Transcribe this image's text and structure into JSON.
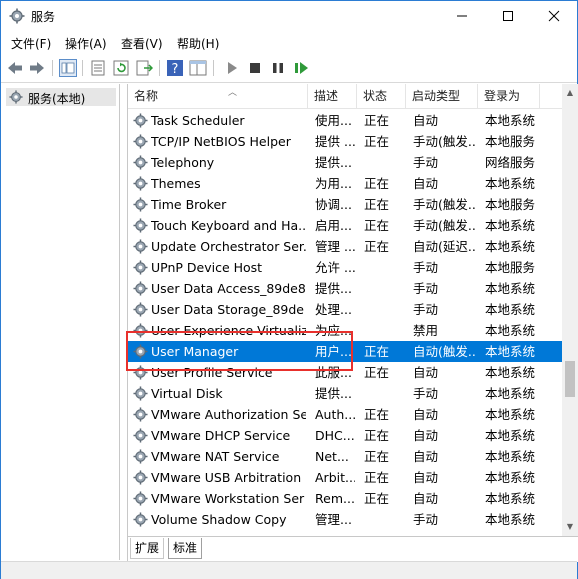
{
  "window": {
    "title": "服务"
  },
  "menu": [
    "文件(F)",
    "操作(A)",
    "查看(V)",
    "帮助(H)"
  ],
  "toolbar_icons": [
    "back-arrow-icon",
    "forward-arrow-icon",
    "console-tree-icon",
    "properties-icon",
    "refresh-icon",
    "export-list-icon",
    "help-icon",
    "show-hide-icon",
    "start-service-icon",
    "stop-service-icon",
    "pause-service-icon",
    "resume-service-icon"
  ],
  "tree": {
    "root_label": "服务(本地)"
  },
  "columns": [
    "名称",
    "描述",
    "状态",
    "启动类型",
    "登录为"
  ],
  "services": [
    {
      "name": "Task Scheduler",
      "desc": "使用...",
      "status": "正在",
      "startup": "自动",
      "logon": "本地系统"
    },
    {
      "name": "TCP/IP NetBIOS Helper",
      "desc": "提供 ...",
      "status": "正在",
      "startup": "手动(触发...",
      "logon": "本地服务"
    },
    {
      "name": "Telephony",
      "desc": "提供...",
      "status": "",
      "startup": "手动",
      "logon": "网络服务"
    },
    {
      "name": "Themes",
      "desc": "为用...",
      "status": "正在",
      "startup": "自动",
      "logon": "本地系统"
    },
    {
      "name": "Time Broker",
      "desc": "协调...",
      "status": "正在",
      "startup": "手动(触发...",
      "logon": "本地服务"
    },
    {
      "name": "Touch Keyboard and Ha...",
      "desc": "启用...",
      "status": "正在",
      "startup": "手动(触发...",
      "logon": "本地系统"
    },
    {
      "name": "Update Orchestrator Ser...",
      "desc": "管理 ...",
      "status": "正在",
      "startup": "自动(延迟...",
      "logon": "本地系统"
    },
    {
      "name": "UPnP Device Host",
      "desc": "允许 ...",
      "status": "",
      "startup": "手动",
      "logon": "本地服务"
    },
    {
      "name": "User Data Access_89de8d",
      "desc": "提供...",
      "status": "",
      "startup": "手动",
      "logon": "本地系统"
    },
    {
      "name": "User Data Storage_89de",
      "desc": "处理...",
      "status": "",
      "startup": "手动",
      "logon": "本地系统"
    },
    {
      "name": "User Experience Virtualiz...",
      "desc": "为应...",
      "status": "",
      "startup": "禁用",
      "logon": "本地系统"
    },
    {
      "name": "User Manager",
      "desc": "用户...",
      "status": "正在",
      "startup": "自动(触发...",
      "logon": "本地系统",
      "selected": true
    },
    {
      "name": "User Profile Service",
      "desc": "此服...",
      "status": "正在",
      "startup": "自动",
      "logon": "本地系统"
    },
    {
      "name": "Virtual Disk",
      "desc": "提供...",
      "status": "",
      "startup": "手动",
      "logon": "本地系统"
    },
    {
      "name": "VMware Authorization Se...",
      "desc": "Auth...",
      "status": "正在",
      "startup": "自动",
      "logon": "本地系统"
    },
    {
      "name": "VMware DHCP Service",
      "desc": "DHC...",
      "status": "正在",
      "startup": "自动",
      "logon": "本地系统"
    },
    {
      "name": "VMware NAT Service",
      "desc": "Net...",
      "status": "正在",
      "startup": "自动",
      "logon": "本地系统"
    },
    {
      "name": "VMware USB Arbitration ...",
      "desc": "Arbit...",
      "status": "正在",
      "startup": "自动",
      "logon": "本地系统"
    },
    {
      "name": "VMware Workstation Ser",
      "desc": "Rem...",
      "status": "正在",
      "startup": "自动",
      "logon": "本地系统"
    },
    {
      "name": "Volume Shadow Copy",
      "desc": "管理...",
      "status": "",
      "startup": "手动",
      "logon": "本地系统"
    }
  ],
  "tabs": [
    "扩展",
    "标准"
  ],
  "colors": {
    "selection": "#0078d7",
    "highlight_box": "#e8302c"
  }
}
